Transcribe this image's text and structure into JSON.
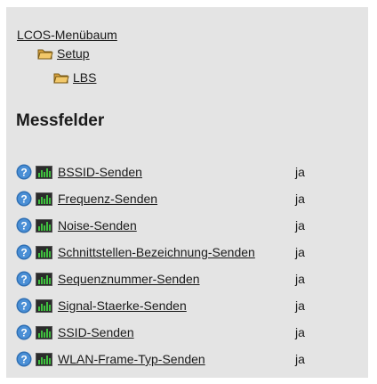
{
  "tree": {
    "root_label": "LCOS-Menübaum",
    "path": [
      {
        "label": "Setup",
        "icon": "folder-icon"
      },
      {
        "label": "LBS",
        "icon": "folder-icon"
      }
    ]
  },
  "section_title": "Messfelder",
  "parameters": [
    {
      "name": "BSSID-Senden",
      "value": "ja"
    },
    {
      "name": "Frequenz-Senden",
      "value": "ja"
    },
    {
      "name": "Noise-Senden",
      "value": "ja"
    },
    {
      "name": "Schnittstellen-Bezeichnung-Senden",
      "value": "ja"
    },
    {
      "name": "Sequenznummer-Senden",
      "value": "ja"
    },
    {
      "name": "Signal-Staerke-Senden",
      "value": "ja"
    },
    {
      "name": "SSID-Senden",
      "value": "ja"
    },
    {
      "name": "WLAN-Frame-Typ-Senden",
      "value": "ja"
    }
  ],
  "icons": {
    "help": "help-icon",
    "parameter": "chart-icon"
  },
  "colors": {
    "panel_bg": "#e4e4e4",
    "help_blue": "#2f6fb3",
    "chart_green": "#3fbf3f"
  }
}
